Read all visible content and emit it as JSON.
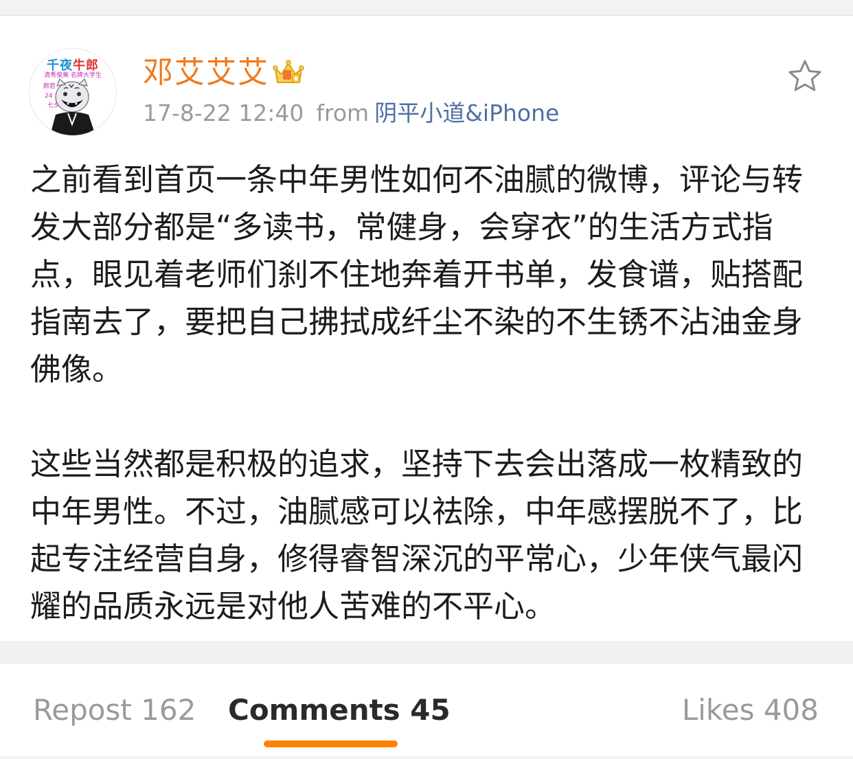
{
  "post": {
    "avatar": {
      "title_main": "千夜",
      "title_accent": "牛郎",
      "lines": [
        "清秀俊美  名牌大学生",
        "颜若",
        "24",
        "七夕"
      ]
    },
    "username": "邓艾艾艾",
    "vip_icon": "vip-crown-icon",
    "timestamp": "17-8-22 12:40",
    "from_label": "from",
    "source": "阴平小道&iPhone",
    "favorite_icon": "star-outline-icon",
    "paragraphs": [
      "之前看到首页一条中年男性如何不油腻的微博，评论与转发大部分都是“多读书，常健身，会穿衣”的生活方式指点，眼见着老师们刹不住地奔着开书单，发食谱，贴搭配指南去了，要把自己拂拭成纤尘不染的不生锈不沾油金身佛像。",
      "这些当然都是积极的追求，坚持下去会出落成一枚精致的中年男性。不过，油腻感可以祛除，中年感摆脱不了，比起专注经营自身，修得睿智深沉的平常心，少年侠气最闪耀的品质永远是对他人苦难的不平心。"
    ]
  },
  "tabs": {
    "repost": "Repost 162",
    "comments": "Comments 45",
    "likes": "Likes 408",
    "active": "comments"
  },
  "colors": {
    "username": "#f07a1c",
    "source_link": "#4f6fa3",
    "active_underline": "#ff8200",
    "meta_gray": "#9a9a9a"
  }
}
